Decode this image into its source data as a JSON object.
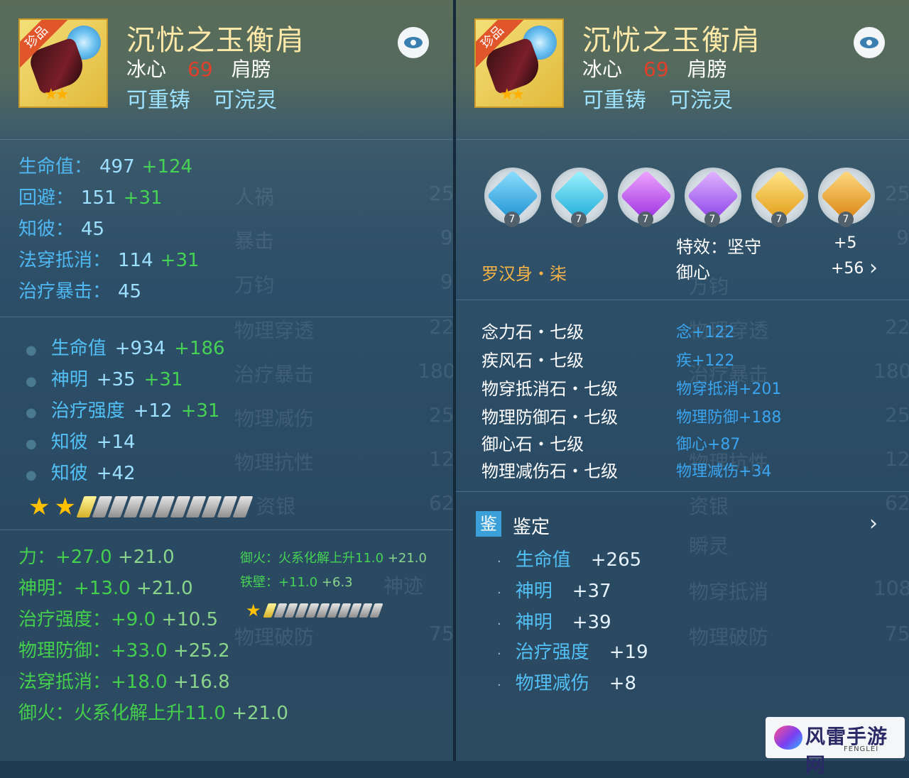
{
  "item": {
    "title": "沉忧之玉衡肩",
    "quality_ribbon": "珍品",
    "school": "冰心",
    "level": "69",
    "slot": "肩膀",
    "tags": [
      "可重铸",
      "可浣灵"
    ]
  },
  "left_panel": {
    "base_stats": [
      {
        "label": "生命值：",
        "value": "497",
        "bonus": "+124"
      },
      {
        "label": "回避：",
        "value": "151",
        "bonus": "+31"
      },
      {
        "label": "知彼：",
        "value": "45",
        "bonus": ""
      },
      {
        "label": "法穿抵消：",
        "value": "114",
        "bonus": "+31"
      },
      {
        "label": "治疗暴击：",
        "value": "45",
        "bonus": ""
      }
    ],
    "extra_stats": [
      {
        "label": "生命值",
        "value": "+934",
        "bonus": "+186"
      },
      {
        "label": "神明",
        "value": "+35",
        "bonus": "+31"
      },
      {
        "label": "治疗强度",
        "value": "+12",
        "bonus": "+31"
      },
      {
        "label": "知彼",
        "value": "+14",
        "bonus": ""
      },
      {
        "label": "知彼",
        "value": "+42",
        "bonus": ""
      }
    ],
    "refine_stats": [
      {
        "label": "力：",
        "value": "+27.0",
        "bonus": "+21.0"
      },
      {
        "label": "神明：",
        "value": "+13.0",
        "bonus": "+21.0"
      },
      {
        "label": "治疗强度：",
        "value": "+9.0",
        "bonus": "+10.5"
      },
      {
        "label": "物理防御：",
        "value": "+33.0",
        "bonus": "+25.2"
      },
      {
        "label": "法穿抵消：",
        "value": "+18.0",
        "bonus": "+16.8"
      },
      {
        "label": "御火：",
        "value": "火系化解上升11.0",
        "bonus": "+21.0"
      }
    ],
    "side_stats": [
      {
        "text": "御火：火系化解上升11.0",
        "bonus": "+21.0"
      },
      {
        "text": "铁壁：+11.0",
        "bonus": "+6.3"
      }
    ],
    "bg_words": [
      "人祸",
      "暴击",
      "万钧",
      "物理穿透",
      "治疗暴击",
      "物理减伤",
      "物理抗性",
      "资银",
      "神迹",
      "物理破防"
    ],
    "bg_nums": [
      "25",
      "9",
      "9",
      "22",
      "180",
      "25",
      "12",
      "62",
      "75"
    ]
  },
  "right_panel": {
    "gem_level": "7",
    "effects": [
      {
        "label": "特效：坚守",
        "value": "+5"
      },
      {
        "label": "御心",
        "value": "+56"
      }
    ],
    "set_name": "罗汉身・柒",
    "stones": [
      {
        "name": "念力石・七级",
        "effect": "念+122"
      },
      {
        "name": "疾风石・七级",
        "effect": "疾+122"
      },
      {
        "name": "物穿抵消石・七级",
        "effect": "物穿抵消+201"
      },
      {
        "name": "物理防御石・七级",
        "effect": "物理防御+188"
      },
      {
        "name": "御心石・七级",
        "effect": "御心+87"
      },
      {
        "name": "物理减伤石・七级",
        "effect": "物理减伤+34"
      }
    ],
    "appraisal": {
      "badge": "鉴",
      "title": "鉴定",
      "items": [
        {
          "label": "生命值",
          "value": "+265"
        },
        {
          "label": "神明",
          "value": "+37"
        },
        {
          "label": "神明",
          "value": "+39"
        },
        {
          "label": "治疗强度",
          "value": "+19"
        },
        {
          "label": "物理减伤",
          "value": "+8"
        }
      ]
    },
    "bg_words": [
      "万钧",
      "物理穿透",
      "治疗暴击",
      "物理抗性",
      "资银",
      "瞬灵",
      "物穿抵消",
      "物理破防"
    ],
    "bg_nums": [
      "25",
      "9",
      "22",
      "180",
      "25",
      "12",
      "62",
      "108",
      "75"
    ]
  },
  "watermark": {
    "name": "风雷手游网",
    "sub": "FENGLEI"
  },
  "colors": {
    "title": "#ffe9a8",
    "level": "#e0402a",
    "tag": "#9ee3ff",
    "stat_label": "#4fb8f2",
    "bonus_green": "#46d254",
    "set_orange": "#f5b246",
    "stone_effect": "#3ba4ee"
  }
}
